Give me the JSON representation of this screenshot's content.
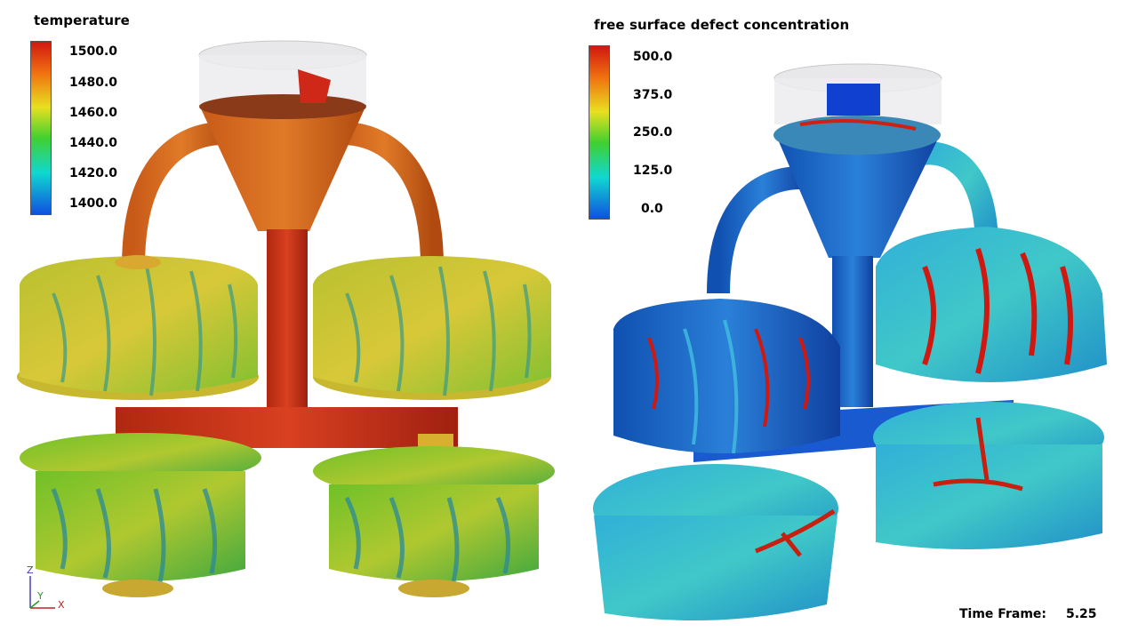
{
  "left_legend": {
    "title": "temperature",
    "ticks": [
      "1500.0",
      "1480.0",
      "1460.0",
      "1440.0",
      "1420.0",
      "1400.0"
    ]
  },
  "right_legend": {
    "title": "free surface defect concentration",
    "ticks": [
      "500.0",
      "375.0",
      "250.0",
      "125.0",
      "0.0"
    ]
  },
  "axes": {
    "z": "Z",
    "y": "Y",
    "x": "X"
  },
  "timeframe": {
    "label": "Time Frame:",
    "value": "5.25"
  },
  "colors": {
    "temp_high": "#d02010",
    "temp_low": "#2030c0",
    "defect_high": "#d00010",
    "defect_low": "#1030d0"
  }
}
